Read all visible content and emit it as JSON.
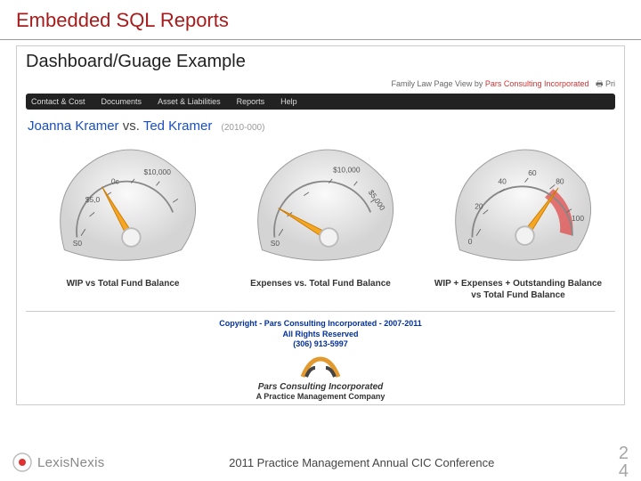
{
  "slide": {
    "title": "Embedded SQL Reports",
    "subtitle": "Dashboard/Guage Example",
    "footer_text": "2011 Practice Management Annual CIC Conference",
    "page_line1": "2",
    "page_line2": "4",
    "lexis_brand": "LexisNexis"
  },
  "topbar": {
    "breadcrumb_label": "Family Law Page View",
    "breadcrumb_by": "by",
    "breadcrumb_company": "Pars Consulting Incorporated",
    "print": "Pri"
  },
  "navbar": {
    "items": [
      "Contact & Cost",
      "Documents",
      "Asset & Liabilities",
      "Reports",
      "Help"
    ]
  },
  "case": {
    "party_a": "Joanna Kramer",
    "vs": "vs.",
    "party_b": "Ted Kramer",
    "number": "(2010-000)"
  },
  "gauges": [
    {
      "caption": "WIP vs Total Fund Balance",
      "ticks": [
        "S0",
        "$5,0",
        "0c",
        "$10,000"
      ],
      "needle_deg": -30,
      "redzone": false
    },
    {
      "caption": "Expenses vs. Total Fund Balance",
      "ticks": [
        "S0",
        "$5,000",
        "$10,000"
      ],
      "needle_deg": -60,
      "redzone": false
    },
    {
      "caption": "WIP + Expenses + Outstanding Balance vs Total Fund Balance",
      "ticks": [
        "0",
        "20",
        "40",
        "60",
        "80",
        "100"
      ],
      "needle_deg": 35,
      "redzone": true
    }
  ],
  "copyright": {
    "line1": "Copyright - Pars Consulting Incorporated - 2007-2011",
    "line2": "All Rights Reserved",
    "line3": "(306) 913-5997",
    "logo_line1": "Pars Consulting Incorporated",
    "logo_line2": "A Practice Management Company"
  },
  "chart_data": [
    {
      "type": "gauge",
      "title": "WIP vs Total Fund Balance",
      "min": 0,
      "max": 10000,
      "tick_labels": [
        "$0",
        "$5,000",
        "$10,000"
      ],
      "value_estimate": 3500,
      "has_danger_zone": false
    },
    {
      "type": "gauge",
      "title": "Expenses vs. Total Fund Balance",
      "min": 0,
      "max": 10000,
      "tick_labels": [
        "$0",
        "$5,000",
        "$10,000"
      ],
      "value_estimate": 1500,
      "has_danger_zone": false
    },
    {
      "type": "gauge",
      "title": "WIP + Expenses + Outstanding Balance vs Total Fund Balance",
      "min": 0,
      "max": 100,
      "tick_labels": [
        "0",
        "20",
        "40",
        "60",
        "80",
        "100"
      ],
      "value_estimate": 75,
      "has_danger_zone": true,
      "danger_zone": [
        70,
        100
      ]
    }
  ]
}
